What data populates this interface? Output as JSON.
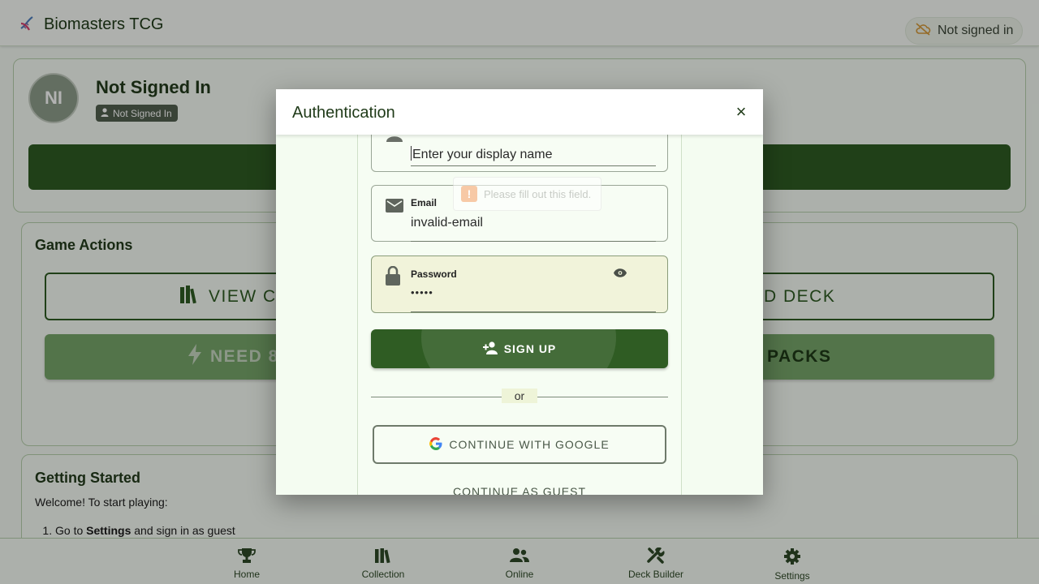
{
  "header": {
    "app_title": "Biomasters TCG",
    "status_chip": "Not signed in"
  },
  "profile": {
    "initials": "NI",
    "name": "Not Signed In",
    "badge": "Not Signed In"
  },
  "game_actions": {
    "title": "Game Actions",
    "view_collection_visible": "VIEW CO",
    "build_deck_visible": "D DECK",
    "need_visible": "NEED 8",
    "packs_visible": "PACKS"
  },
  "getting_started": {
    "title": "Getting Started",
    "intro": "Welcome! To start playing:",
    "step1_prefix": "Go to ",
    "step1_bold": "Settings",
    "step1_suffix": " and sign in as guest"
  },
  "bottom_nav": [
    {
      "label": "Home",
      "icon": "trophy-icon"
    },
    {
      "label": "Collection",
      "icon": "books-icon"
    },
    {
      "label": "Online",
      "icon": "users-icon"
    },
    {
      "label": "Deck Builder",
      "icon": "tools-icon"
    },
    {
      "label": "Settings",
      "icon": "gear-icon"
    }
  ],
  "auth_modal": {
    "title": "Authentication",
    "close": "×",
    "display_name": {
      "placeholder": "Enter your display name"
    },
    "email": {
      "label": "Email",
      "value": "invalid-email"
    },
    "password": {
      "label": "Password",
      "value": "•••••"
    },
    "validation_tooltip": "Please fill out this field.",
    "signup_label": "SIGN UP",
    "or_label": "or",
    "google_label": "CONTINUE WITH GOOGLE",
    "guest_label": "CONTINUE AS GUEST"
  },
  "colors": {
    "primary": "#2f5c23",
    "accent_green": "#77a76b",
    "background": "#f4faf2"
  }
}
